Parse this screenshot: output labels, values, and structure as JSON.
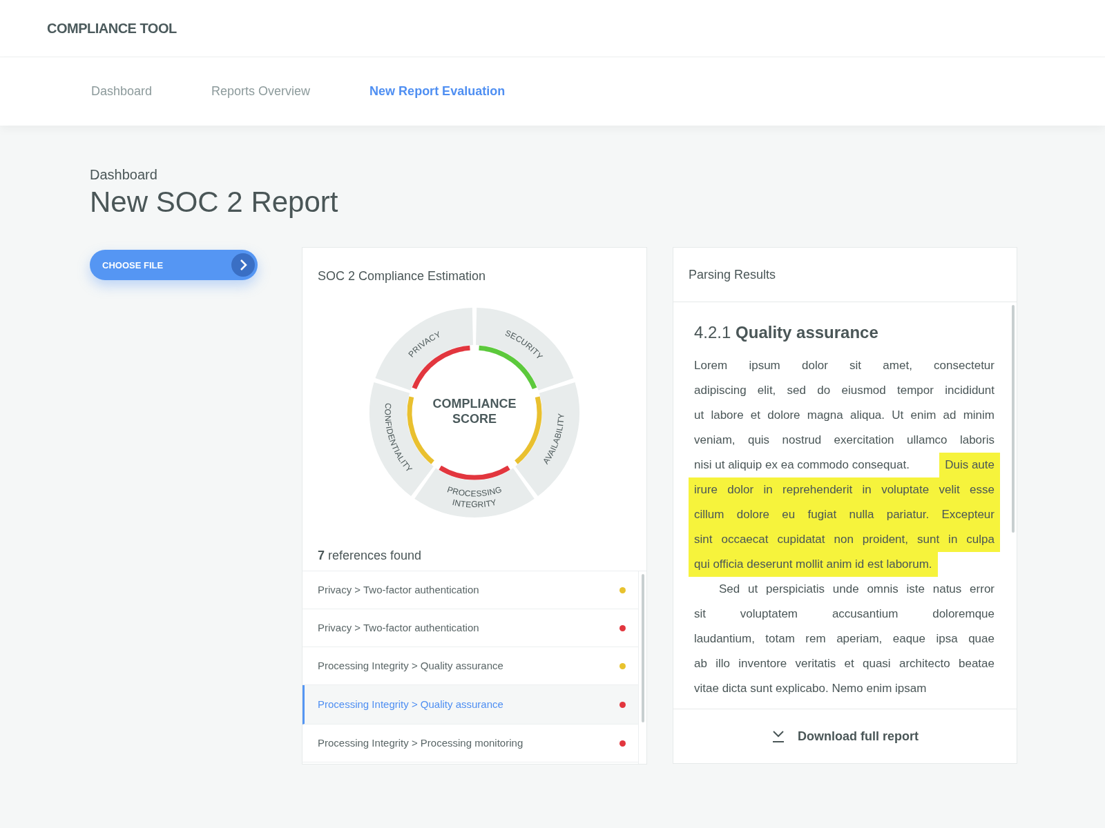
{
  "app": {
    "logo": "COMPLIANCE TOOL"
  },
  "nav": [
    {
      "label": "Dashboard",
      "selected": false
    },
    {
      "label": "Reports Overview",
      "selected": false
    },
    {
      "label": "New Report Evaluation",
      "selected": true
    }
  ],
  "breadcrumb": "Dashboard",
  "title": "New SOC 2 Report",
  "choose_file": "CHOOSE FILE",
  "estimation": {
    "title": "SOC 2 Compliance Estimation",
    "center_label": "COMPLIANCE SCORE",
    "segments": [
      {
        "label_lines": [
          "SECURITY"
        ],
        "color": "#5cc93c"
      },
      {
        "label_lines": [
          "AVAILABILITY"
        ],
        "color": "#e9c02f"
      },
      {
        "label_lines": [
          "PROCESSING",
          "INTEGRITY"
        ],
        "color": "#e2363e"
      },
      {
        "label_lines": [
          "CONFIDENTIALITY"
        ],
        "color": "#e9c02f"
      },
      {
        "label_lines": [
          "PRIVACY"
        ],
        "color": "#e2363e"
      }
    ],
    "references_label": "**7** references found",
    "references": [
      {
        "text": "Privacy > Two-factor authentication",
        "color": "#e8c22e",
        "selected": false
      },
      {
        "text": "Privacy > Two-factor authentication",
        "color": "#e2363e",
        "selected": false
      },
      {
        "text": "Processing Integrity > Quality assurance",
        "color": "#e8c22e",
        "selected": false
      },
      {
        "text": "Processing Integrity > Quality assurance",
        "color": "#e2363e",
        "selected": true
      },
      {
        "text": "Processing Integrity > Processing monitoring",
        "color": "#e2363e",
        "selected": false
      }
    ]
  },
  "parsing": {
    "title": "Parsing Results",
    "heading": "4.2.1 **Quality assurance**",
    "paragraphs": [
      {
        "lines": [
          [
            {
              "text": "Lorem ipsum dolor sit amet, consectetur",
              "highlighted": false
            }
          ],
          [
            {
              "text": "adipiscing elit, sed do eiusmod tempor incididunt",
              "highlighted": false
            }
          ],
          [
            {
              "text": "ut labore et dolore magna aliqua. Ut enim ad minim",
              "highlighted": false
            }
          ],
          [
            {
              "text": "veniam, quis nostrud exercitation ullamco laboris",
              "highlighted": false
            }
          ],
          [
            {
              "text": "nisi ut aliquip ex ea commodo consequat.",
              "highlighted": false
            },
            {
              "text": "Duis aute",
              "highlighted": true
            }
          ],
          [
            {
              "text": "irure dolor in reprehenderit in voluptate velit esse",
              "highlighted": true
            }
          ],
          [
            {
              "text": "cillum dolore eu fugiat nulla pariatur. Excepteur",
              "highlighted": true
            }
          ],
          [
            {
              "text": "sint occaecat cupidatat non proident, sunt in culpa",
              "highlighted": true
            }
          ],
          [
            {
              "text": "qui officia deserunt mollit anim id est laborum.",
              "highlighted": true
            }
          ]
        ]
      },
      {
        "lines": [
          [
            {
              "text": "Sed ut perspiciatis unde omnis iste natus error",
              "highlighted": false
            }
          ],
          [
            {
              "text": "sit voluptatem accusantium doloremque",
              "highlighted": false
            }
          ],
          [
            {
              "text": "laudantium, totam rem aperiam, eaque ipsa quae",
              "highlighted": false
            }
          ],
          [
            {
              "text": "ab illo inventore veritatis et quasi architecto beatae",
              "highlighted": false
            }
          ],
          [
            {
              "text": "vitae dicta sunt explicabo. Nemo enim ipsam",
              "highlighted": false
            }
          ]
        ]
      }
    ],
    "download": "Download full report"
  }
}
